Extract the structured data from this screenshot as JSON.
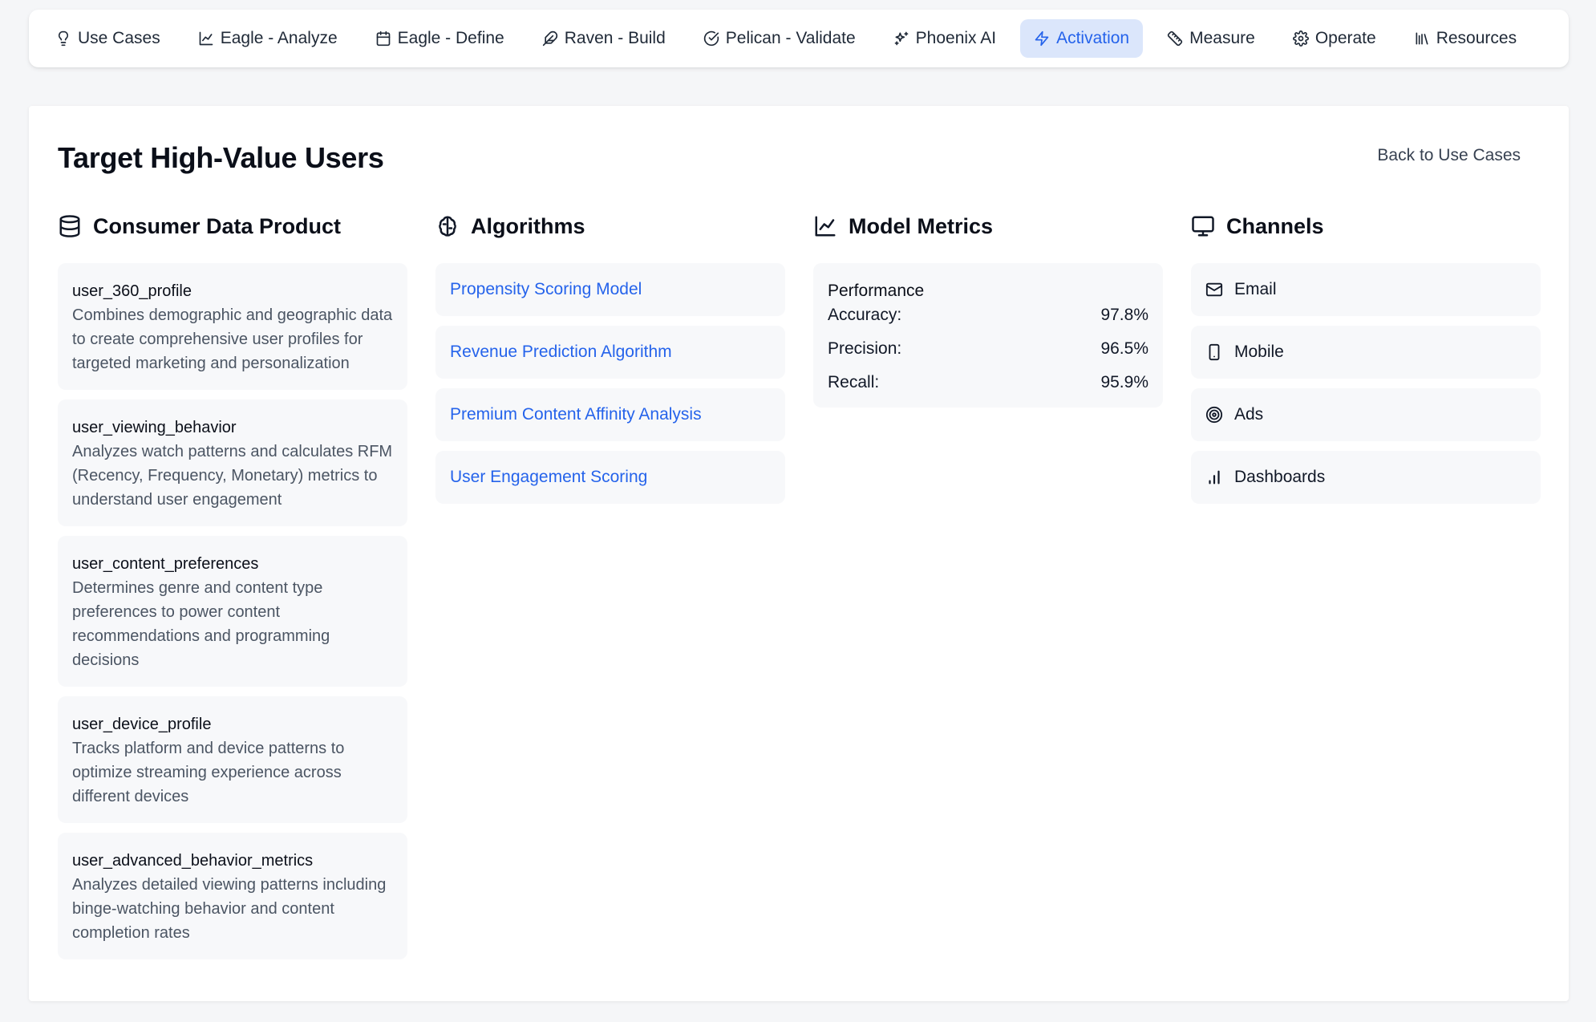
{
  "nav": {
    "items": [
      {
        "label": "Use Cases",
        "icon": "lightbulb-icon"
      },
      {
        "label": "Eagle - Analyze",
        "icon": "line-chart-icon"
      },
      {
        "label": "Eagle - Define",
        "icon": "calendar-icon"
      },
      {
        "label": "Raven - Build",
        "icon": "feather-icon"
      },
      {
        "label": "Pelican - Validate",
        "icon": "check-circle-icon"
      },
      {
        "label": "Phoenix AI",
        "icon": "sparkles-icon"
      },
      {
        "label": "Activation",
        "icon": "lightning-icon",
        "active": true
      },
      {
        "label": "Measure",
        "icon": "ruler-icon"
      },
      {
        "label": "Operate",
        "icon": "gear-icon"
      },
      {
        "label": "Resources",
        "icon": "library-icon"
      }
    ],
    "active_color": "#2563eb",
    "active_bg": "#dbe6fb"
  },
  "page": {
    "title": "Target High-Value Users",
    "back_label": "Back to Use Cases"
  },
  "consumer_data_product": {
    "title": "Consumer Data Product",
    "icon": "database-icon",
    "items": [
      {
        "name": "user_360_profile",
        "desc": "Combines demographic and geographic data to create comprehensive user profiles for targeted marketing and personalization"
      },
      {
        "name": "user_viewing_behavior",
        "desc": "Analyzes watch patterns and calculates RFM (Recency, Frequency, Monetary) metrics to understand user engagement"
      },
      {
        "name": "user_content_preferences",
        "desc": "Determines genre and content type preferences to power content recommendations and programming decisions"
      },
      {
        "name": "user_device_profile",
        "desc": "Tracks platform and device patterns to optimize streaming experience across different devices"
      },
      {
        "name": "user_advanced_behavior_metrics",
        "desc": "Analyzes detailed viewing patterns including binge-watching behavior and content completion rates"
      }
    ]
  },
  "algorithms": {
    "title": "Algorithms",
    "icon": "brain-icon",
    "items": [
      "Propensity Scoring Model",
      "Revenue Prediction Algorithm",
      "Premium Content Affinity Analysis",
      "User Engagement Scoring"
    ]
  },
  "model_metrics": {
    "title": "Model Metrics",
    "icon": "line-chart-icon",
    "section": "Performance",
    "rows": [
      {
        "label": "Accuracy:",
        "value": "97.8%"
      },
      {
        "label": "Precision:",
        "value": "96.5%"
      },
      {
        "label": "Recall:",
        "value": "95.9%"
      }
    ]
  },
  "channels": {
    "title": "Channels",
    "icon": "monitor-icon",
    "items": [
      {
        "label": "Email",
        "icon": "mail-icon"
      },
      {
        "label": "Mobile",
        "icon": "smartphone-icon"
      },
      {
        "label": "Ads",
        "icon": "target-icon"
      },
      {
        "label": "Dashboards",
        "icon": "bar-chart-icon"
      }
    ]
  }
}
